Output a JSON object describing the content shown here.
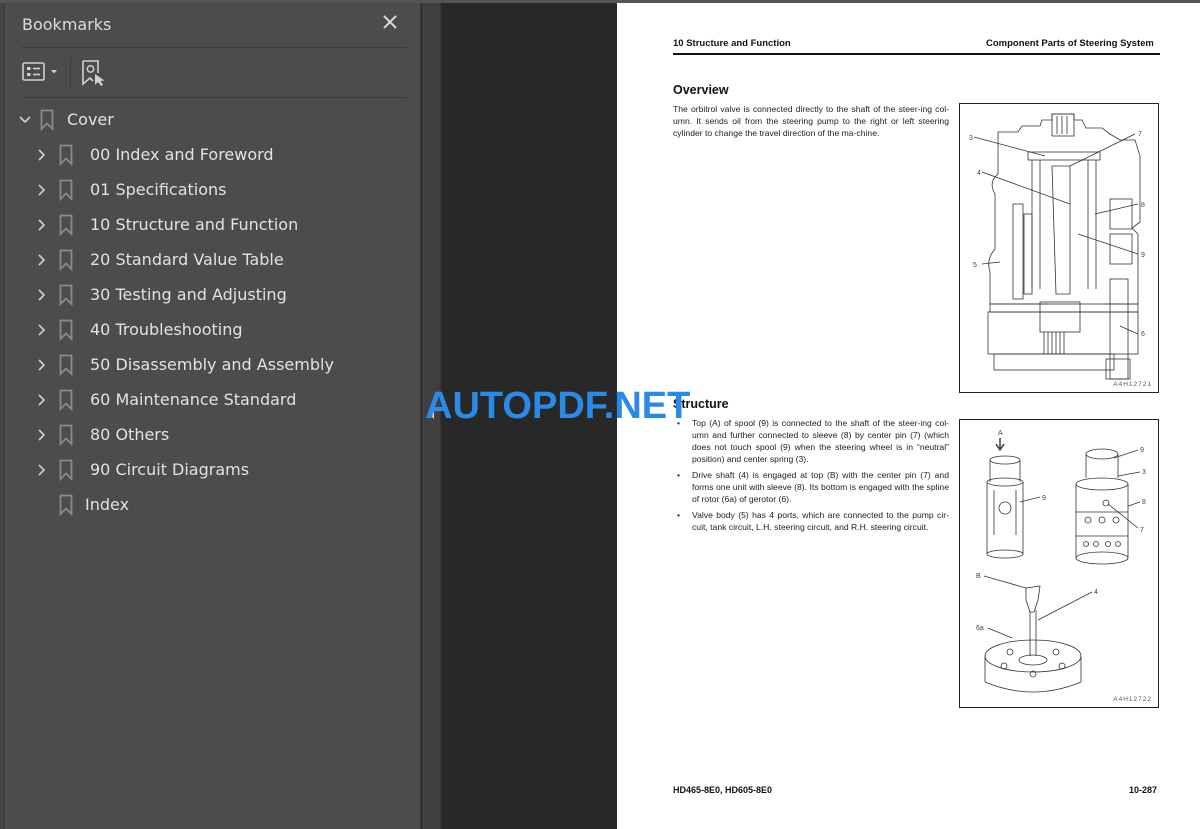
{
  "sidebar": {
    "title": "Bookmarks",
    "close_icon": "close-icon",
    "toolbar": {
      "options_icon": "list-options-icon",
      "find_icon": "find-bookmark-icon"
    },
    "items": [
      {
        "label": "Cover",
        "expanded": true,
        "level": 0
      },
      {
        "label": "00 Index and Foreword",
        "expanded": false,
        "level": 1
      },
      {
        "label": "01 Specifications",
        "expanded": false,
        "level": 1
      },
      {
        "label": "10 Structure and Function",
        "expanded": false,
        "level": 1
      },
      {
        "label": "20 Standard Value Table",
        "expanded": false,
        "level": 1
      },
      {
        "label": "30 Testing and Adjusting",
        "expanded": false,
        "level": 1
      },
      {
        "label": "40 Troubleshooting",
        "expanded": false,
        "level": 1
      },
      {
        "label": "50 Disassembly and Assembly",
        "expanded": false,
        "level": 1
      },
      {
        "label": "60 Maintenance Standard",
        "expanded": false,
        "level": 1
      },
      {
        "label": "80 Others",
        "expanded": false,
        "level": 1
      },
      {
        "label": "90 Circuit Diagrams",
        "expanded": false,
        "level": 1
      },
      {
        "label": "Index",
        "expanded": null,
        "level": 1
      }
    ]
  },
  "watermark": "AUTOPDF.NET",
  "page": {
    "header_left": "10 Structure and Function",
    "header_right": "Component Parts of Steering System",
    "overview": {
      "heading": "Overview",
      "text": "The orbitrol valve is connected directly to the shaft of the steer-ing col-umn. It sends oil from the steering pump to the right or left steering cylinder to change the travel direction of the ma-chine."
    },
    "structure": {
      "heading": "Structure",
      "bullets": [
        "Top (A) of spool (9) is connected to the shaft of the steer-ing col-umn and further connected to sleeve (8) by center pin (7) (which does not touch spool (9) when the steering wheel is in “neutral” position) and center spring (3).",
        "Drive shaft (4) is engaged at top (B) with the center pin (7) and forms one unit with sleeve (8). Its bottom is engaged with the spline of rotor (6a) of gerotor (6).",
        "Valve body (5) has 4 ports, which are connected to the pump cir-cuit, tank circuit, L.H. steering circuit, and R.H. steering circuit."
      ]
    },
    "figure1": {
      "code": "A4H12721",
      "callouts": [
        "3",
        "7",
        "4",
        "8",
        "9",
        "5",
        "6"
      ]
    },
    "figure2": {
      "code": "A4H12722",
      "callouts": [
        "A",
        "9",
        "9",
        "3",
        "8",
        "7",
        "B",
        "4",
        "6a"
      ]
    },
    "footer_left": "HD465-8E0, HD605-8E0",
    "footer_right": "10-287"
  }
}
